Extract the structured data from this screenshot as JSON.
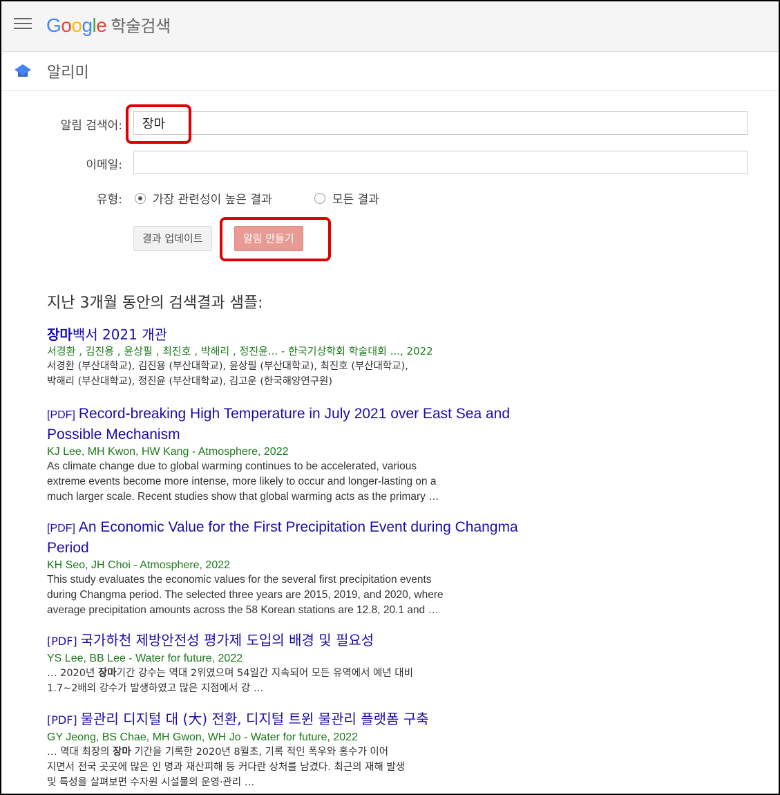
{
  "header": {
    "logo_text": "Google",
    "product_name": "학술검색"
  },
  "subheader": {
    "title": "알리미"
  },
  "form": {
    "query_label": "알림 검색어:",
    "query_value": "장마",
    "email_label": "이메일:",
    "email_value": "",
    "type_label": "유형:",
    "type_options": [
      {
        "label": "가장 관련성이 높은 결과",
        "checked": true
      },
      {
        "label": "모든 결과",
        "checked": false
      }
    ],
    "update_button": "결과 업데이트",
    "create_button": "알림 만들기"
  },
  "sample_heading": "지난 3개월 동안의 검색결과 샘플:",
  "results": [
    {
      "pdf": "",
      "title_bold": "장마",
      "title_rest": "백서 2021 개관",
      "authors": "서경환 , 김진용 , 윤상필 , 최진호 , 박해리 , 정진윤... - 한국기상학회 학술대회 ..., 2022",
      "snippet_lines": [
        "서경환 (부산대학교), 김진용 (부산대학교), 윤상필 (부산대학교), 최진호 (부산대학교),",
        "박해리 (부산대학교), 정진윤 (부산대학교), 김고운 (한국해양연구원)"
      ]
    },
    {
      "pdf": "[PDF]",
      "title_lines": [
        "Record-breaking High Temperature in July 2021 over East Sea and",
        "Possible Mechanism"
      ],
      "authors": "KJ Lee, MH Kwon, HW Kang - Atmosphere, 2022",
      "snippet_lines": [
        "As climate change due to global warming continues to be accelerated, various",
        "extreme events become more intense, more likely to occur and longer-lasting on a",
        "much larger scale. Recent studies show that global warming acts as the primary …"
      ]
    },
    {
      "pdf": "[PDF]",
      "title_lines": [
        "An Economic Value for the First Precipitation Event during Changma",
        "Period"
      ],
      "authors": "KH Seo, JH Choi - Atmosphere, 2022",
      "snippet_lines": [
        "This study evaluates the economic values for the several first precipitation events",
        "during Changma period. The selected three years are 2015, 2019, and 2020, where",
        "average precipitation amounts across the 58 Korean stations are 12.8, 20.1 and …"
      ]
    },
    {
      "pdf": "[PDF]",
      "title": "국가하천 제방안전성 평가제 도입의 배경 및 필요성",
      "authors": "YS Lee, BB Lee - Water for future, 2022",
      "snippet_l1_pre": "… 2020년 ",
      "snippet_l1_bold": "장마",
      "snippet_l1_post": "기간 강수는 역대 2위였으며 54일간 지속되어 모든 유역에서 예년 대비",
      "snippet_l2": "1.7~2배의 강수가 발생하였고 많은 지점에서 강 …"
    },
    {
      "pdf": "[PDF]",
      "title": "물관리 디지털 대 (大) 전환, 디지털 트윈 물관리 플랫폼 구축",
      "authors": "GY Jeong, BS Chae, MH Gwon, WH Jo - Water for future, 2022",
      "snippet_l1_pre": "… 역대 최장의 ",
      "snippet_l1_bold": "장마",
      "snippet_l1_post": " 기간을 기록한 2020년 8월초, 기록 적인 폭우와 홍수가 이어",
      "snippet_l2": "지면서 전국 곳곳에 많은 인 명과 재산피해 등 커다란 상처를 남겼다. 최근의 재해 발생",
      "snippet_l3": "및 특성을 살펴보면 수자원 시설물의 운영·관리 …"
    }
  ]
}
